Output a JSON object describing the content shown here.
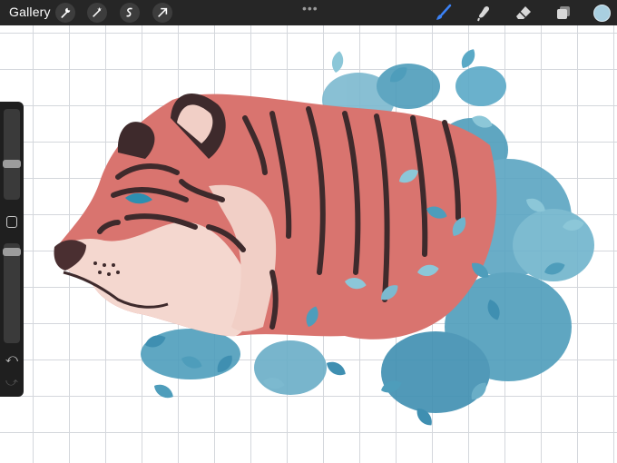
{
  "toolbar": {
    "gallery_label": "Gallery",
    "more_dots": "•••",
    "left_tools": [
      "wrench-icon",
      "magic-wand-icon",
      "selection-icon",
      "transform-arrow-icon"
    ],
    "right_tools": [
      "brush-icon",
      "smudge-icon",
      "eraser-icon",
      "layers-icon"
    ],
    "active_tool": "brush-icon",
    "accent_color": "#3b82f6",
    "current_color": "#a9cfe0"
  },
  "sidebar": {
    "brush_size_level": 0.72,
    "opacity_level": 0.95,
    "undo_glyph": "⤺",
    "redo_glyph": "⤻"
  },
  "canvas": {
    "artwork": "tiger-with-blue-leaves",
    "grid": true,
    "palette": {
      "stripes": "#3e2a2c",
      "fur": "#d9746f",
      "fur_light": "#f4d7cf",
      "leaves": "#4e9dbb",
      "leaves_light": "#8cc7d8"
    }
  }
}
